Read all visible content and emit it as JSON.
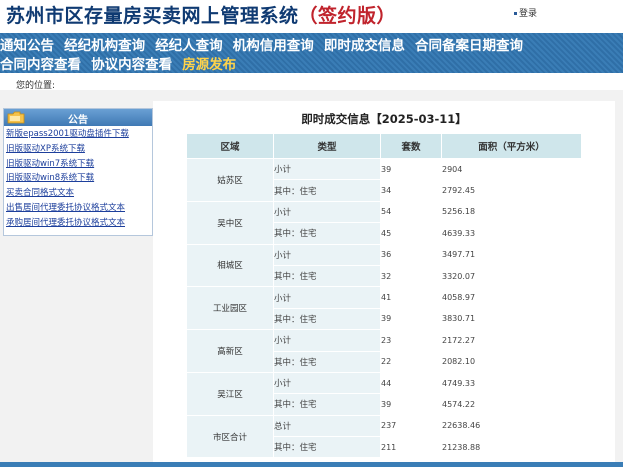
{
  "header": {
    "title_main": "苏州市区存量房买卖网上管理系统",
    "title_edition": "（签约版）",
    "login_label": "登录"
  },
  "nav": {
    "row1": [
      "通知公告",
      "经纪机构查询",
      "经纪人查询",
      "机构信用查询",
      "即时成交信息",
      "合同备案日期查询"
    ],
    "row2": [
      "合同内容查看",
      "协议内容查看",
      "房源发布"
    ],
    "active": "房源发布"
  },
  "location_label": "您的位置:",
  "sidebar": {
    "title": "公告",
    "items": [
      "新版epass2001驱动盘插件下载",
      "旧版驱动XP系统下载",
      "旧版驱动win7系统下载",
      "旧版驱动win8系统下载",
      "买卖合同格式文本",
      "出售居间代理委托协议格式文本",
      "承购居间代理委托协议格式文本"
    ]
  },
  "main": {
    "title": "即时成交信息【2025-03-11】",
    "columns": [
      "区域",
      "类型",
      "套数",
      "面积（平方米）"
    ],
    "rows": [
      {
        "district": "姑苏区",
        "r1": {
          "type": "小计",
          "count": "39",
          "area": "2904"
        },
        "r2": {
          "type": "其中：住宅",
          "count": "34",
          "area": "2792.45"
        }
      },
      {
        "district": "吴中区",
        "r1": {
          "type": "小计",
          "count": "54",
          "area": "5256.18"
        },
        "r2": {
          "type": "其中：住宅",
          "count": "45",
          "area": "4639.33"
        }
      },
      {
        "district": "相城区",
        "r1": {
          "type": "小计",
          "count": "36",
          "area": "3497.71"
        },
        "r2": {
          "type": "其中：住宅",
          "count": "32",
          "area": "3320.07"
        }
      },
      {
        "district": "工业园区",
        "r1": {
          "type": "小计",
          "count": "41",
          "area": "4058.97"
        },
        "r2": {
          "type": "其中：住宅",
          "count": "39",
          "area": "3830.71"
        }
      },
      {
        "district": "高新区",
        "r1": {
          "type": "小计",
          "count": "23",
          "area": "2172.27"
        },
        "r2": {
          "type": "其中：住宅",
          "count": "22",
          "area": "2082.10"
        }
      },
      {
        "district": "吴江区",
        "r1": {
          "type": "小计",
          "count": "44",
          "area": "4749.33"
        },
        "r2": {
          "type": "其中：住宅",
          "count": "39",
          "area": "4574.22"
        }
      },
      {
        "district": "市区合计",
        "r1": {
          "type": "总计",
          "count": "237",
          "area": "22638.46"
        },
        "r2": {
          "type": "其中：住宅",
          "count": "211",
          "area": "21238.88"
        }
      }
    ]
  },
  "colors": {
    "title_blue": "#0f3a72",
    "title_red": "#c0232c",
    "nav_bg": "#3a7db6",
    "nav_active": "#ffd34a",
    "table_header": "#cfe6eb",
    "table_cell": "#eaf3f6"
  },
  "icons": {
    "login": "square-bullet-icon",
    "sidebar": "folder-icon"
  }
}
